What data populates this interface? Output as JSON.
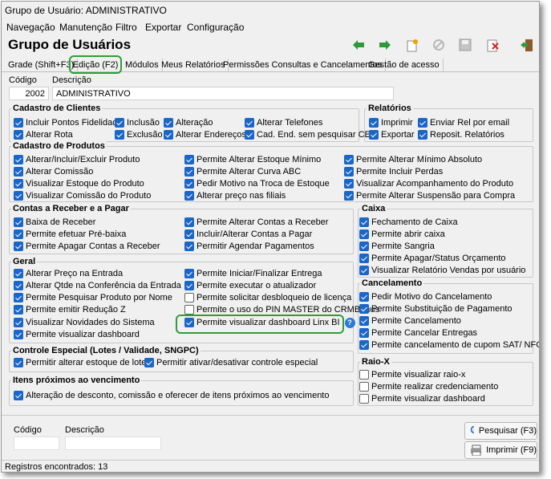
{
  "title": "Grupo de Usuário: ADMINISTRATIVO",
  "menu": [
    "Navegação",
    "Manutenção",
    "Filtro",
    "Exportar",
    "Configuração"
  ],
  "header": "Grupo de Usuários",
  "tabs": [
    "Grade (Shift+F3)",
    "Edição (F2)",
    "Módulos",
    "Meus Relatórios",
    "Permissões Consultas e Cancelamentos",
    "Gestão de acesso"
  ],
  "form": {
    "codigo_label": "Código",
    "descricao_label": "Descrição",
    "codigo": "2002",
    "descricao": "ADMINISTRATIVO"
  },
  "groups": {
    "cadastro_clientes": {
      "title": "Cadastro de Clientes",
      "items": [
        {
          "label": "Incluir Pontos Fidelidade",
          "checked": true
        },
        {
          "label": "Inclusão",
          "checked": true
        },
        {
          "label": "Alteração",
          "checked": true
        },
        {
          "label": "Alterar Telefones",
          "checked": true
        },
        {
          "label": "Alterar Rota",
          "checked": true
        },
        {
          "label": "Exclusão",
          "checked": true
        },
        {
          "label": "Alterar Endereços",
          "checked": true
        },
        {
          "label": "Cad. End. sem pesquisar CEP",
          "checked": true
        }
      ]
    },
    "relatorios": {
      "title": "Relatórios",
      "items": [
        {
          "label": "Imprimir",
          "checked": true
        },
        {
          "label": "Enviar Rel por email",
          "checked": true
        },
        {
          "label": "Exportar",
          "checked": true
        },
        {
          "label": "Reposit. Relatórios",
          "checked": true
        }
      ]
    },
    "cadastro_produtos": {
      "title": "Cadastro de Produtos",
      "items": [
        {
          "label": "Alterar/Incluir/Excluir Produto",
          "checked": true
        },
        {
          "label": "Permite Alterar Estoque Mínimo",
          "checked": true
        },
        {
          "label": "Permite Alterar Mínimo Absoluto",
          "checked": true
        },
        {
          "label": "Alterar Comissão",
          "checked": true
        },
        {
          "label": "Permite Alterar Curva ABC",
          "checked": true
        },
        {
          "label": "Permite Incluir Perdas",
          "checked": true
        },
        {
          "label": "Visualizar Estoque do Produto",
          "checked": true
        },
        {
          "label": "Pedir Motivo na Troca de Estoque",
          "checked": true
        },
        {
          "label": "Visualizar Acompanhamento do Produto",
          "checked": true
        },
        {
          "label": "Visualizar Comissão do Produto",
          "checked": true
        },
        {
          "label": "Alterar preço nas filiais",
          "checked": true
        },
        {
          "label": "Permite Alterar Suspensão para Compra",
          "checked": true
        }
      ]
    },
    "contas": {
      "title": "Contas a Receber e a Pagar",
      "items": [
        {
          "label": "Baixa de Receber",
          "checked": true
        },
        {
          "label": "Permite Alterar Contas a Receber",
          "checked": true
        },
        {
          "label": "Permite efetuar Pré-baixa",
          "checked": true
        },
        {
          "label": "Incluir/Alterar Contas a Pagar",
          "checked": true
        },
        {
          "label": "Permite Apagar Contas a Receber",
          "checked": true
        },
        {
          "label": "Permitir Agendar Pagamentos",
          "checked": true
        }
      ]
    },
    "caixa": {
      "title": "Caixa",
      "items": [
        {
          "label": "Fechamento de Caixa",
          "checked": true
        },
        {
          "label": "Permite abrir caixa",
          "checked": true
        },
        {
          "label": "Permite Sangria",
          "checked": true
        },
        {
          "label": "Permite Apagar/Status Orçamento",
          "checked": true
        },
        {
          "label": "Visualizar Relatório Vendas por usuário",
          "checked": true
        }
      ]
    },
    "geral": {
      "title": "Geral",
      "items": [
        {
          "label": "Alterar Preço na Entrada",
          "checked": true
        },
        {
          "label": "Permite Iniciar/Finalizar Entrega",
          "checked": true
        },
        {
          "label": "Alterar Qtde na Conferência da Entrada",
          "checked": true
        },
        {
          "label": "Permite executar o atualizador",
          "checked": true
        },
        {
          "label": "Permite Pesquisar Produto por Nome",
          "checked": true
        },
        {
          "label": "Permite solicitar desbloqueio de licença",
          "checked": false
        },
        {
          "label": "Permite emitir Redução Z",
          "checked": true
        },
        {
          "label": "Permite o uso do PIN MASTER do CRMBônus",
          "checked": false
        },
        {
          "label": "Visualizar Novidades do Sistema",
          "checked": true
        },
        {
          "label": "Permite visualizar dashboard Linx BI",
          "checked": true
        },
        {
          "label": "Permite visualizar dashboard",
          "checked": true
        }
      ]
    },
    "cancelamento": {
      "title": "Cancelamento",
      "items": [
        {
          "label": "Pedir Motivo do Cancelamento",
          "checked": true
        },
        {
          "label": "Permite Substituição de Pagamento",
          "checked": true
        },
        {
          "label": "Permite Cancelamento",
          "checked": true
        },
        {
          "label": "Permite Cancelar Entregas",
          "checked": true
        },
        {
          "label": "Permite cancelamento de cupom SAT/ NFC-e",
          "checked": true
        }
      ]
    },
    "controle": {
      "title": "Controle Especial (Lotes / Validade, SNGPC)",
      "items": [
        {
          "label": "Permitir alterar estoque de lotes",
          "checked": true
        },
        {
          "label": "Permitir ativar/desativar controle especial",
          "checked": true
        }
      ]
    },
    "raiox": {
      "title": "Raio-X",
      "items": [
        {
          "label": "Permite visualizar raio-x",
          "checked": false
        },
        {
          "label": "Permite realizar credenciamento",
          "checked": false
        },
        {
          "label": "Permite visualizar dashboard",
          "checked": false
        }
      ]
    },
    "itens": {
      "title": "Itens próximos ao vencimento",
      "items": [
        {
          "label": "Alteração de desconto, comissão e oferecer de itens próximos ao vencimento",
          "checked": true
        }
      ]
    }
  },
  "bottom": {
    "codigo_label": "Código",
    "descricao_label": "Descrição",
    "pesquisar": "Pesquisar (F3)",
    "imprimir": "Imprimir (F9)"
  },
  "status": "Registros encontrados: 13",
  "help_icon": "?",
  "colors": {
    "accent": "#1a66c9",
    "highlight": "#2e9e3a"
  }
}
